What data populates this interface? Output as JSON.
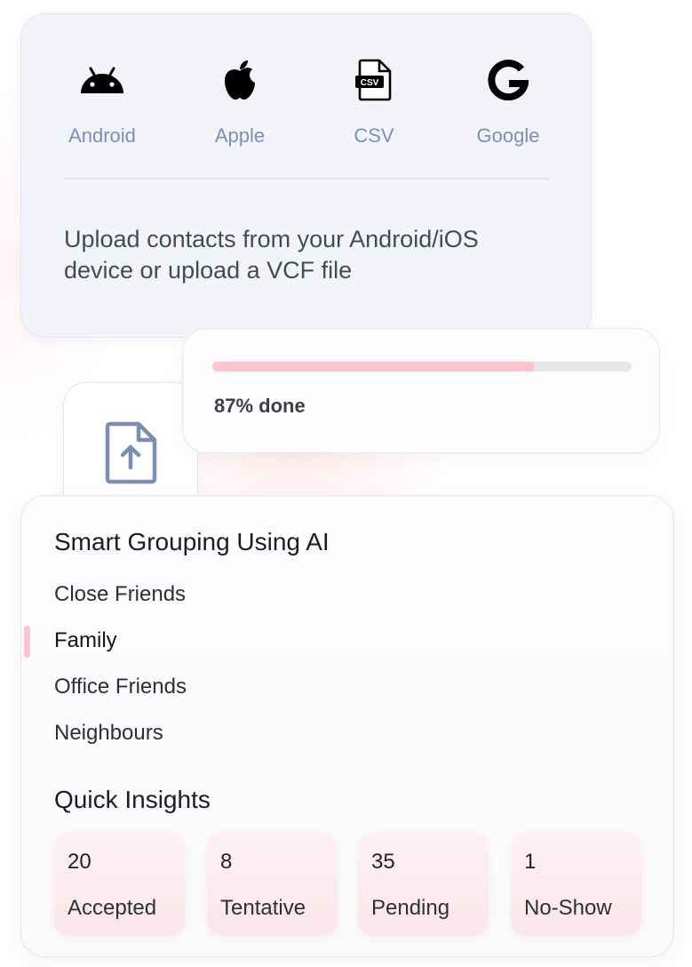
{
  "import": {
    "sources": [
      {
        "label": "Android",
        "icon": "android-icon"
      },
      {
        "label": "Apple",
        "icon": "apple-icon"
      },
      {
        "label": "CSV",
        "icon": "csv-file-icon",
        "badge": "CSV"
      },
      {
        "label": "Google",
        "icon": "google-icon"
      }
    ],
    "description_line1": "Upload contacts from your Android/iOS",
    "description_line2": "device or upload a VCF file"
  },
  "upload": {
    "progress_percent": 77,
    "status_text": "87% done",
    "icon": "file-upload-icon"
  },
  "grouping": {
    "title": "Smart Grouping Using AI",
    "groups": [
      {
        "label": "Close Friends",
        "active": false
      },
      {
        "label": "Family",
        "active": true
      },
      {
        "label": "Office Friends",
        "active": false
      },
      {
        "label": "Neighbours",
        "active": false
      }
    ]
  },
  "insights": {
    "title": "Quick Insights",
    "stats": [
      {
        "value": "20",
        "label": "Accepted"
      },
      {
        "value": "8",
        "label": "Tentative"
      },
      {
        "value": "35",
        "label": "Pending"
      },
      {
        "value": "1",
        "label": "No-Show"
      }
    ]
  },
  "colors": {
    "accent_pink": "#fdc4ce",
    "source_label": "#7c8fb6",
    "upload_icon": "#7b8eb6"
  }
}
